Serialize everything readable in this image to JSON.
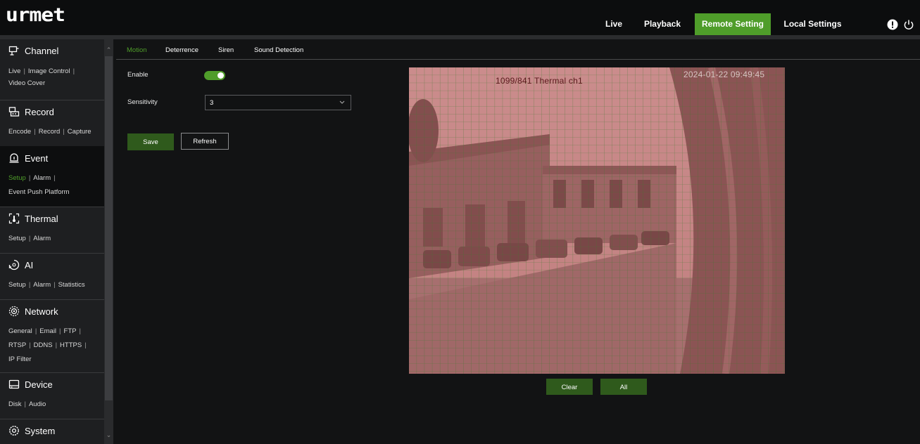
{
  "app": {
    "logo_text": "urmet"
  },
  "nav": {
    "items": [
      {
        "label": "Live"
      },
      {
        "label": "Playback"
      },
      {
        "label": "Remote Setting",
        "active": true
      },
      {
        "label": "Local Settings"
      }
    ],
    "icons": [
      "alert-icon",
      "power-icon"
    ]
  },
  "sidebar": {
    "sections": [
      {
        "title": "Channel",
        "icon": "channel-icon",
        "subs": [
          [
            "Live",
            "Image Control"
          ],
          [
            "Video Cover"
          ]
        ]
      },
      {
        "title": "Record",
        "icon": "record-icon",
        "subs": [
          [
            "Encode",
            "Record",
            "Capture"
          ]
        ]
      },
      {
        "title": "Event",
        "icon": "event-icon",
        "active": true,
        "subs": [
          [
            "Setup",
            "Alarm"
          ],
          [
            "Event Push Platform"
          ]
        ],
        "active_sub": "Setup"
      },
      {
        "title": "Thermal",
        "icon": "thermal-icon",
        "subs": [
          [
            "Setup",
            "Alarm"
          ]
        ]
      },
      {
        "title": "AI",
        "icon": "ai-icon",
        "subs": [
          [
            "Setup",
            "Alarm",
            "Statistics"
          ]
        ]
      },
      {
        "title": "Network",
        "icon": "network-icon",
        "subs": [
          [
            "General",
            "Email",
            "FTP"
          ],
          [
            "RTSP",
            "DDNS",
            "HTTPS"
          ],
          [
            "IP Filter"
          ]
        ]
      },
      {
        "title": "Device",
        "icon": "device-icon",
        "subs": [
          [
            "Disk",
            "Audio"
          ]
        ]
      },
      {
        "title": "System",
        "icon": "system-icon",
        "subs": []
      }
    ]
  },
  "tabs": [
    {
      "label": "Motion",
      "active": true
    },
    {
      "label": "Deterrence"
    },
    {
      "label": "Siren"
    },
    {
      "label": "Sound Detection"
    }
  ],
  "form": {
    "enable_label": "Enable",
    "enable_value": true,
    "sensitivity_label": "Sensitivity",
    "sensitivity_value": "3",
    "save_label": "Save",
    "refresh_label": "Refresh"
  },
  "preview": {
    "osd_channel": "1099/841 Thermal ch1",
    "osd_time": "2024-01-22 09:49:45",
    "clear_label": "Clear",
    "all_label": "All"
  },
  "colors": {
    "accent": "#4f9d2a",
    "button_dark": "#2f5a1c",
    "grid_overlay": "#d06a6a"
  }
}
